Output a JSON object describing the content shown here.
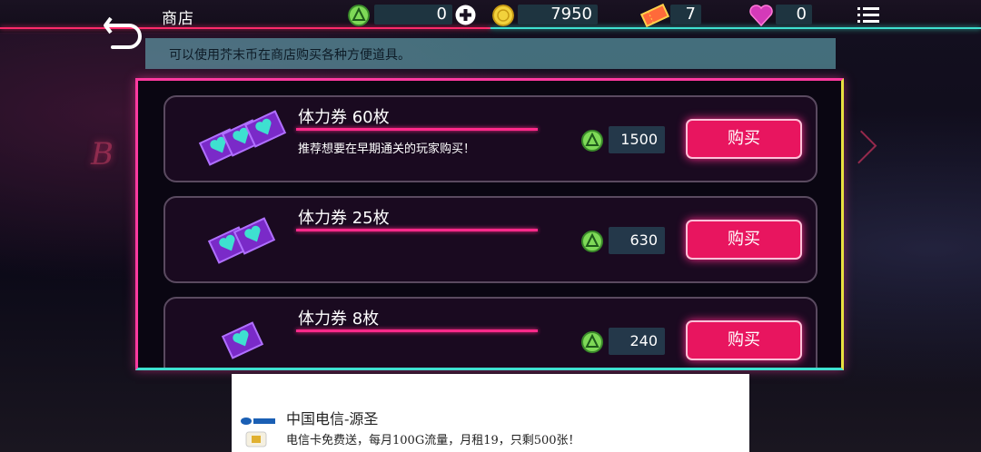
{
  "header": {
    "title": "商店",
    "mustard_coins": "0",
    "gold_coins": "7950",
    "tickets": "7",
    "hearts": "0"
  },
  "notice": "可以使用芥末币在商店购买各种方便道具。",
  "items": [
    {
      "title": "体力券 60枚",
      "desc": "推荐想要在早期通关的玩家购买！",
      "price": "1500",
      "buy_label": "购买"
    },
    {
      "title": "体力券 25枚",
      "desc": "",
      "price": "630",
      "buy_label": "购买"
    },
    {
      "title": "体力券 8枚",
      "desc": "",
      "price": "240",
      "buy_label": "购买"
    }
  ],
  "ad": {
    "title": "中国电信-源圣",
    "desc": "电信卡免费送，每月100G流量，月租19，只剩500张！"
  },
  "colors": {
    "accent_pink": "#ff2a8a",
    "accent_cyan": "#3ee0d0",
    "accent_yellow": "#e8e040",
    "buy_button": "#e8155f"
  },
  "icons": [
    "back-icon",
    "mustard-coin-icon",
    "plus-icon",
    "gold-coin-icon",
    "ticket-icon",
    "heart-icon",
    "menu-icon",
    "stamina-ticket-icon"
  ]
}
